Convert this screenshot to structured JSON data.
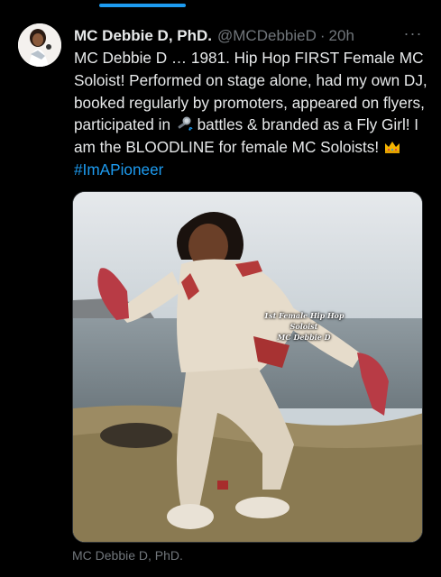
{
  "tweet": {
    "author_name": "MC Debbie D, PhD.",
    "handle": "@MCDebbieD",
    "separator": "·",
    "time": "20h",
    "more_label": "···",
    "text_line1": "MC Debbie D … 1981. Hip Hop FIRST Female MC Soloist! Performed on stage alone, had my own DJ, booked regularly by promoters, appeared on flyers, participated in",
    "mic_emoji_name": "microphone-icon",
    "text_line2": "battles & branded as a Fly Girl! I am the BLOODLINE for female MC Soloists!",
    "crown_emoji_name": "crown-icon",
    "hashtag": "#ImAPioneer"
  },
  "media": {
    "overlay_line1": "1st Female Hip Hop",
    "overlay_line2": "Soloist",
    "overlay_line3": "MC Debbie D",
    "attribution": "MC Debbie D, PhD."
  },
  "colors": {
    "background": "#000000",
    "text": "#e7e9ea",
    "muted": "#71767b",
    "accent": "#1d9bf0"
  }
}
